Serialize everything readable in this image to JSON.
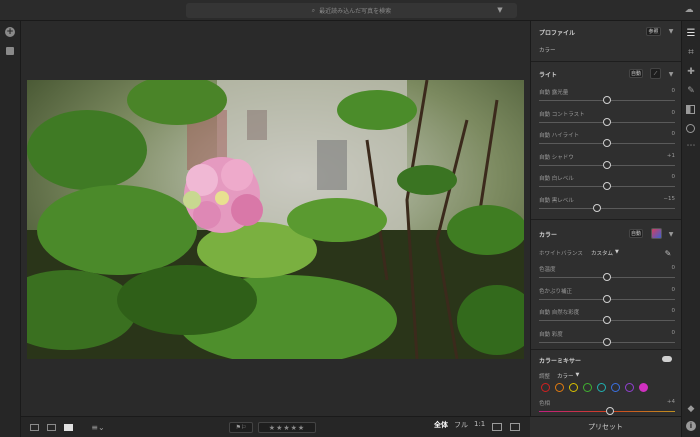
{
  "search": {
    "placeholder": "最近読み込んだ写真を検索"
  },
  "panel": {
    "profile": {
      "title": "プロファイル",
      "browse": "参照",
      "value": "カラー"
    },
    "light": {
      "title": "ライト",
      "auto": "自動",
      "sliders": [
        {
          "label": "自動 露光量",
          "value": "0",
          "pos": 0.5
        },
        {
          "label": "自動 コントラスト",
          "value": "0",
          "pos": 0.5
        },
        {
          "label": "自動 ハイライト",
          "value": "0",
          "pos": 0.5
        },
        {
          "label": "自動 シャドウ",
          "value": "+1",
          "pos": 0.5
        },
        {
          "label": "自動 白レベル",
          "value": "0",
          "pos": 0.5
        },
        {
          "label": "自動 黒レベル",
          "value": "−15",
          "pos": 0.43
        }
      ]
    },
    "color": {
      "title": "カラー",
      "auto": "自動",
      "wb_label": "ホワイトバランス",
      "wb_value": "カスタム",
      "sliders": [
        {
          "label": "色温度",
          "value": "0",
          "pos": 0.5
        },
        {
          "label": "色かぶり補正",
          "value": "0",
          "pos": 0.5
        },
        {
          "label": "自動 自然な彩度",
          "value": "0",
          "pos": 0.5
        },
        {
          "label": "自動 彩度",
          "value": "0",
          "pos": 0.5
        }
      ]
    },
    "mixer": {
      "title": "カラーミキサー",
      "adjust_label": "調整",
      "adjust_value": "カラー",
      "colors": [
        "#d02020",
        "#e07a10",
        "#d8c000",
        "#40b030",
        "#20b0b0",
        "#3a70e0",
        "#9040d0",
        "#d030c0"
      ],
      "hue_label": "色相",
      "hue_value": "+4",
      "hue_pos": 0.52
    }
  },
  "bottom": {
    "all": "全体",
    "full": "フル",
    "ratio": "1:1",
    "preset": "プリセット"
  }
}
